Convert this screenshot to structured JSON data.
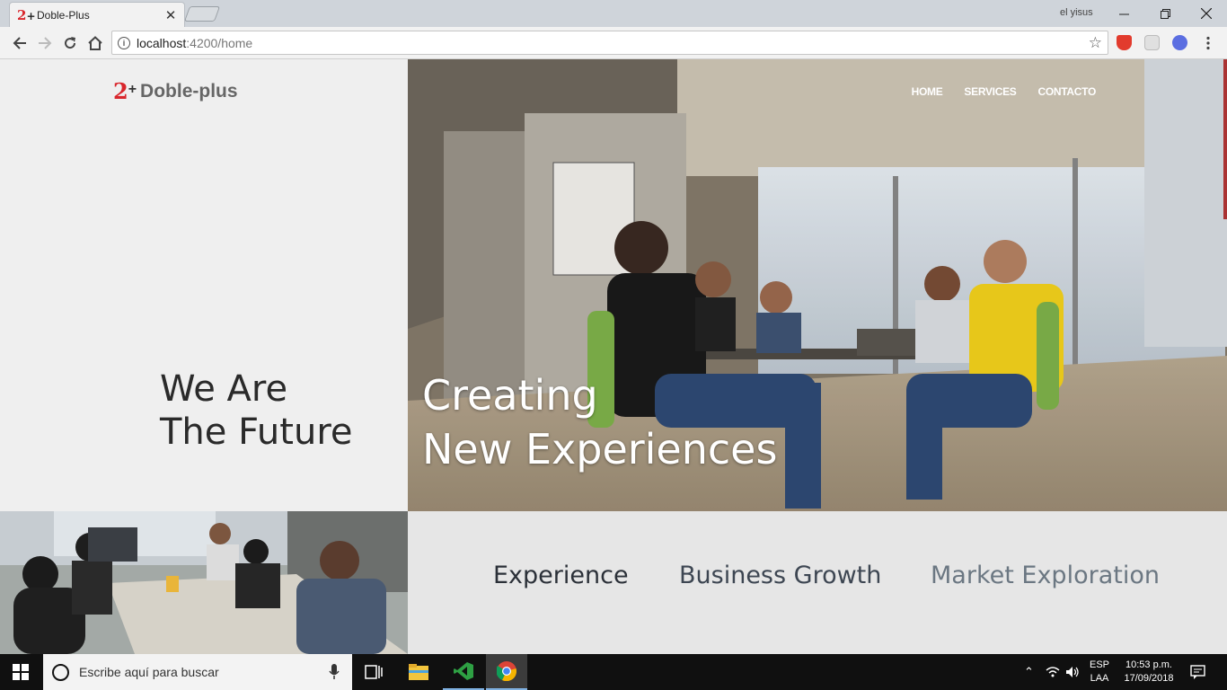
{
  "browser": {
    "tab_title": "Doble-Plus",
    "tab_favicon": "2",
    "profile_name": "el yisus",
    "url_host": "localhost",
    "url_path": ":4200/home"
  },
  "site": {
    "logo_mark": "2",
    "logo_plus": "+",
    "logo_text": "Doble-plus",
    "nav": [
      "HOME",
      "SERVICES",
      "CONTACTO"
    ],
    "tagline": [
      "We Are",
      "The Future"
    ],
    "hero_title": [
      "Creating",
      "New Experiences"
    ],
    "features": [
      "Experience",
      "Business Growth",
      "Market Exploration"
    ]
  },
  "taskbar": {
    "search_placeholder": "Escribe aquí para buscar",
    "lang_top": "ESP",
    "lang_bottom": "LAA",
    "time": "10:53 p.m.",
    "date": "17/09/2018"
  },
  "colors": {
    "brand_red": "#d9262c",
    "feature_active": "#2b3038",
    "feature_mid": "#3d4652",
    "feature_muted": "#6b7782"
  }
}
